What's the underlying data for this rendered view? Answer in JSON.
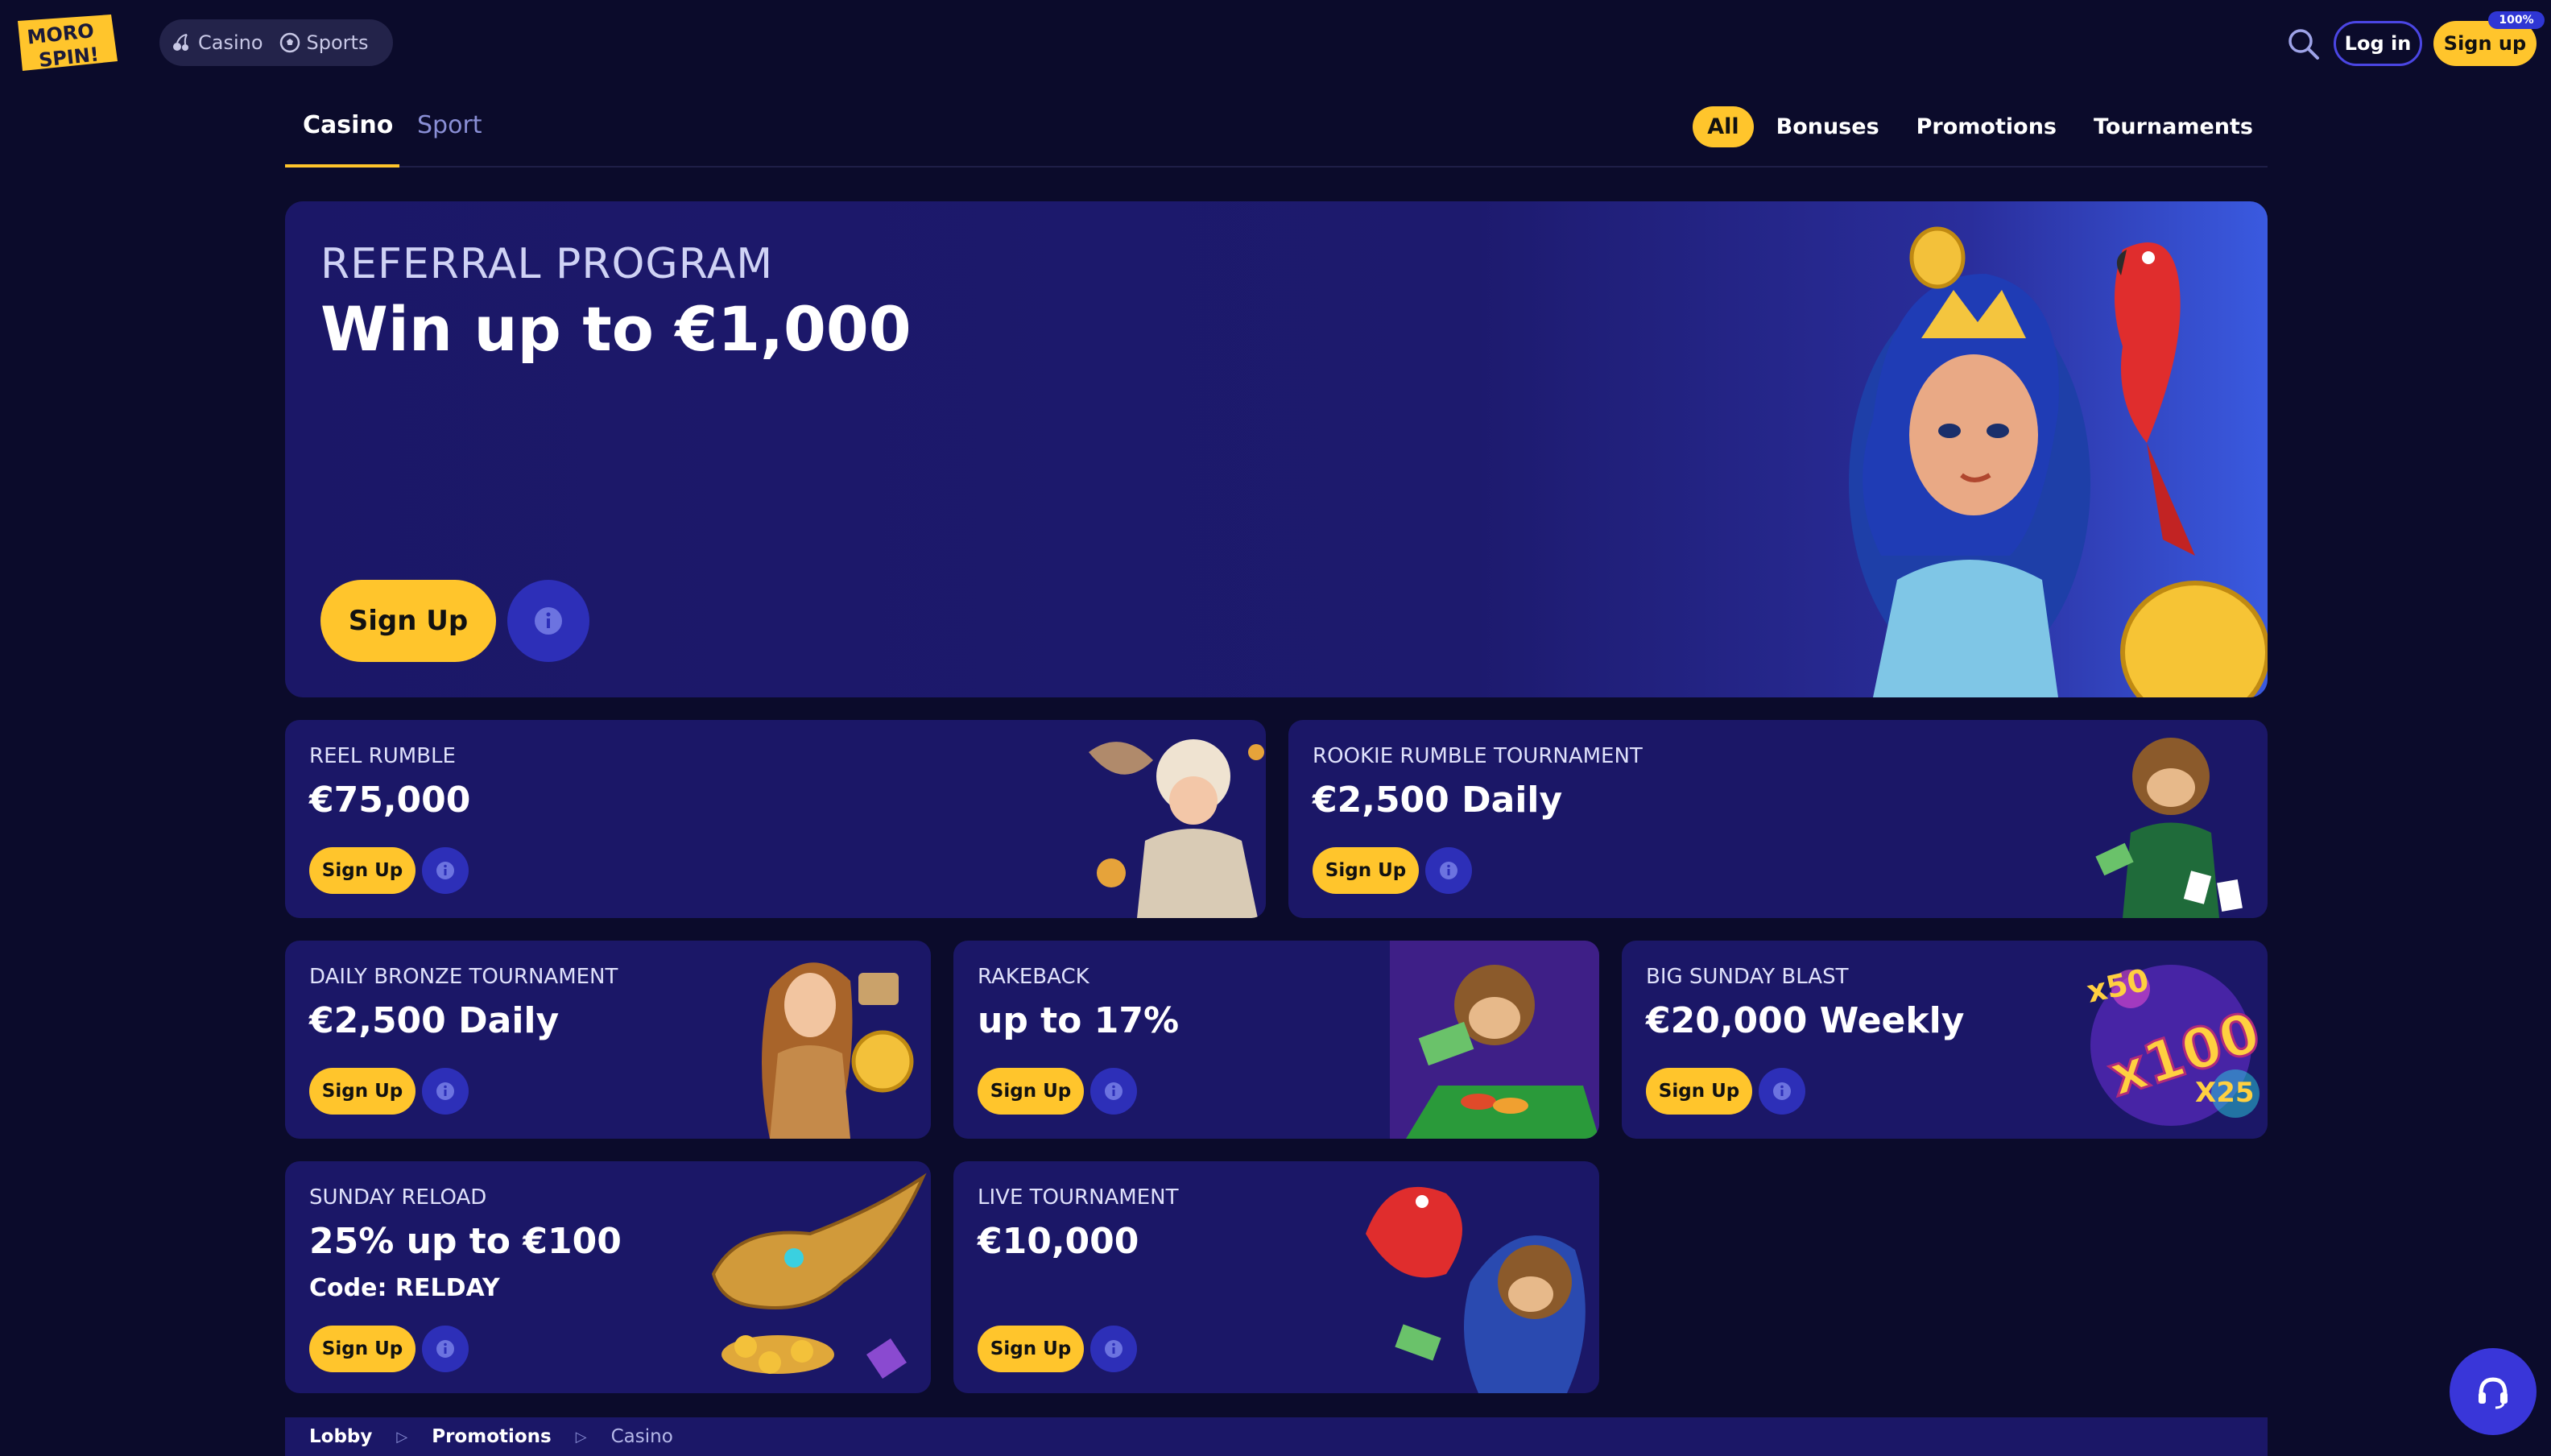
{
  "brand": {
    "line1": "MORO",
    "line2": "SPIN!"
  },
  "modes": [
    {
      "label": "Casino",
      "icon": "cherry-icon"
    },
    {
      "label": "Sports",
      "icon": "soccer-ball-icon"
    }
  ],
  "header": {
    "login": "Log in",
    "signup": "Sign up",
    "badge": "100%"
  },
  "tabs": [
    {
      "label": "Casino",
      "active": true
    },
    {
      "label": "Sport",
      "active": false
    }
  ],
  "filters": [
    {
      "label": "All",
      "active": true
    },
    {
      "label": "Bonuses",
      "active": false
    },
    {
      "label": "Promotions",
      "active": false
    },
    {
      "label": "Tournaments",
      "active": false
    }
  ],
  "hero": {
    "kicker": "REFERRAL PROGRAM",
    "title": "Win up to €1,000",
    "cta": "Sign Up"
  },
  "cards": [
    {
      "kicker": "REEL RUMBLE",
      "title": "€75,000",
      "cta": "Sign Up"
    },
    {
      "kicker": "ROOKIE RUMBLE TOURNAMENT",
      "title": "€2,500 Daily",
      "cta": "Sign Up"
    },
    {
      "kicker": "DAILY BRONZE TOURNAMENT",
      "title": "€2,500 Daily",
      "cta": "Sign Up"
    },
    {
      "kicker": "RAKEBACK",
      "title": "up to 17%",
      "cta": "Sign Up"
    },
    {
      "kicker": "BIG SUNDAY BLAST",
      "title": "€20,000 Weekly",
      "cta": "Sign Up",
      "art": {
        "a": "x50",
        "b": "x100",
        "c": "X25"
      }
    },
    {
      "kicker": "SUNDAY RELOAD",
      "title": "25% up to €100",
      "code": "Code: RELDAY",
      "cta": "Sign Up"
    },
    {
      "kicker": "LIVE TOURNAMENT",
      "title": "€10,000",
      "cta": "Sign Up"
    }
  ],
  "breadcrumb": [
    "Lobby",
    "Promotions",
    "Casino"
  ],
  "colors": {
    "accent": "#ffc52c",
    "bg": "#0b0b2b",
    "card": "#1b1767",
    "info": "#2d2fb8"
  }
}
